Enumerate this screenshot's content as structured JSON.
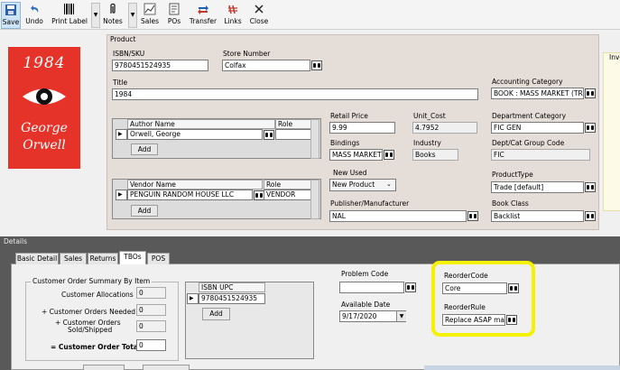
{
  "toolbar": {
    "save": "Save",
    "undo": "Undo",
    "print_label": "Print Label",
    "notes": "Notes",
    "sales": "Sales",
    "pos": "POs",
    "transfer": "Transfer",
    "links": "Links",
    "close": "Close"
  },
  "cover": {
    "title": "1984",
    "author_line1": "George",
    "author_line2": "Orwell"
  },
  "product": {
    "group_label": "Product",
    "isbn_label": "ISBN/SKU",
    "isbn": "9780451524935",
    "store_label": "Store Number",
    "store": "Colfax",
    "title_label": "Title",
    "title": "1984",
    "author_headers": [
      "Author Name",
      "Role"
    ],
    "author_row": {
      "name": "Orwell, George",
      "role": ""
    },
    "add": "Add",
    "vendor_headers": [
      "Vendor Name",
      "Role"
    ],
    "vendor_row": {
      "name": "PENGUIN RANDOM HOUSE LLC",
      "role": "VENDOR"
    },
    "retail_label": "Retail Price",
    "retail": "9.99",
    "unit_cost_label": "Unit_Cost",
    "unit_cost": "4.7952",
    "bindings_label": "Bindings",
    "bindings": "MASS MARKET",
    "industry_label": "Industry",
    "industry": "Books",
    "new_used_label": "New Used",
    "new_used": "New Product",
    "publisher_label": "Publisher/Manufacturer",
    "publisher": "NAL",
    "acct_cat_label": "Accounting Category",
    "acct_cat": "BOOK : MASS MARKET (TR",
    "dept_cat_label": "Department Category",
    "dept_cat": "FIC GEN",
    "dept_group_label": "Dept/Cat Group Code",
    "dept_group": "FIC",
    "product_type_label": "ProductType",
    "product_type": "Trade [default]",
    "book_class_label": "Book Class",
    "book_class": "Backlist",
    "inv_fragment": "Inve"
  },
  "details": {
    "label": "Details",
    "tabs": [
      "Basic Detail",
      "Sales",
      "Returns",
      "TBOs",
      "POS"
    ],
    "active_tab": "TBOs",
    "cust_group_label": "Customer Order Summary By Item",
    "cust_alloc_label": "Customer Allocations",
    "cust_alloc": "0",
    "needed_label": "+ Customer Orders Needed",
    "needed": "0",
    "sold_label_1": "+ Customer Orders",
    "sold_label_2": "Sold/Shipped",
    "sold": "0",
    "total_label": "= Customer Order Total",
    "total": "0",
    "isbn_upc_header": "ISBN UPC",
    "isbn_upc": "9780451524935",
    "add": "Add",
    "problem_code_label": "Problem Code",
    "problem_code": "",
    "available_date_label": "Available Date",
    "available_date": "9/17/2020",
    "reorder_code_label": "ReorderCode",
    "reorder_code": "Core",
    "reorder_rule_label": "ReorderRule",
    "reorder_rule": "Replace ASAP max",
    "highlight_color": "#f5f200"
  }
}
